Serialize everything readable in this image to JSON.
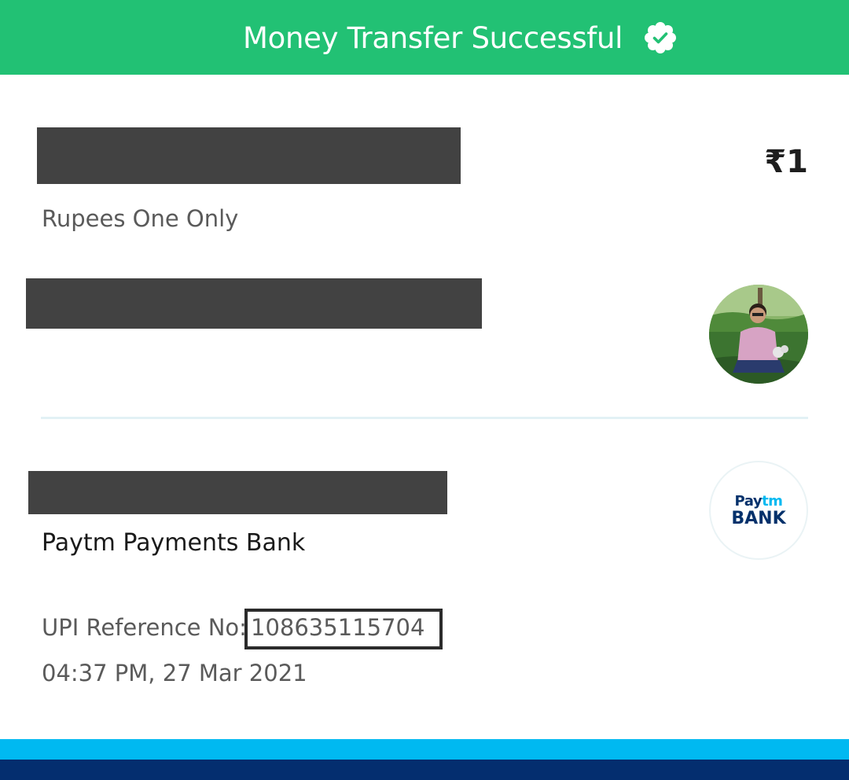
{
  "header": {
    "title": "Money Transfer Successful",
    "status_icon": "verified-check-icon",
    "background_color": "#22c174"
  },
  "payment": {
    "amount": "₹1",
    "amount_in_words": "Rupees One Only"
  },
  "recipient": {
    "avatar": "profile-photo"
  },
  "bank": {
    "name": "Paytm Payments Bank",
    "logo_line1_part1": "Pay",
    "logo_line1_part2": "tm",
    "logo_line2": "BANK"
  },
  "transaction": {
    "upi_reference_label": "UPI Reference No:",
    "upi_reference_number": "108635115704",
    "datetime": "04:37 PM, 27 Mar 2021"
  },
  "colors": {
    "accent_green": "#22c174",
    "paytm_light_blue": "#00b9f1",
    "paytm_dark_blue": "#042e6f",
    "redaction": "#424242"
  }
}
